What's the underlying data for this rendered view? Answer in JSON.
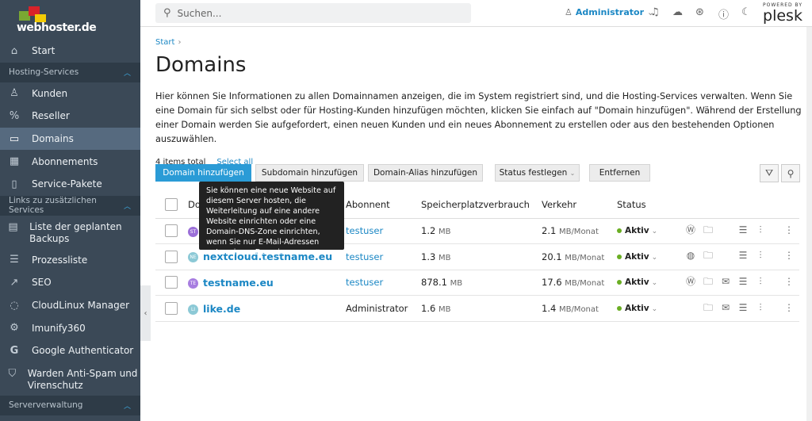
{
  "brand": {
    "logo_text": "webhoster.de",
    "powered_by": "POWERED BY",
    "plesk": "plesk"
  },
  "sidebar": {
    "start": "Start",
    "sections": [
      {
        "title": "Hosting-Services",
        "items": [
          "Kunden",
          "Reseller",
          "Domains",
          "Abonnements",
          "Service-Pakete"
        ]
      },
      {
        "title": "Links zu zusätzlichen Services",
        "items": [
          "Liste der geplanten Backups",
          "Prozessliste",
          "SEO",
          "CloudLinux Manager",
          "Imunify360",
          "Google Authenticator",
          "Warden Anti-Spam und Virenschutz"
        ]
      },
      {
        "title": "Serververwaltung"
      }
    ],
    "active": "Domains"
  },
  "topbar": {
    "search_placeholder": "Suchen...",
    "user": "Administrator"
  },
  "main": {
    "breadcrumb": "Start",
    "title": "Domains",
    "description": "Hier können Sie Informationen zu allen Domainnamen anzeigen, die im System registriert sind, und die Hosting-Services verwalten. Wenn Sie eine Domain für sich selbst oder für Hosting-Kunden hinzufügen möchten, klicken Sie einfach auf \"Domain hinzufügen\". Während der Erstellung einer Domain werden Sie aufgefordert, einen neuen Kunden und ein neues Abonnement zu erstellen oder aus den bestehenden Optionen auszuwählen.",
    "count": "4 items total",
    "select_all": "Select all",
    "buttons": {
      "add_domain": "Domain hinzufügen",
      "add_subdomain": "Subdomain hinzufügen",
      "add_alias": "Domain-Alias hinzufügen",
      "set_status": "Status festlegen",
      "remove": "Entfernen"
    },
    "tooltip": "Sie können eine neue Website auf diesem Server hosten, die Weiterleitung auf eine andere Website einrichten oder eine Domain-DNS-Zone einrichten, wenn Sie nur E-Mail-Adressen unter einem Domainnamen verwenden wollen.",
    "columns": [
      "Do",
      "Abonnent",
      "Speicherplatzverbrauch",
      "Verkehr",
      "Status"
    ],
    "rows": [
      {
        "domain": "",
        "fav": "ST",
        "fav_color": "#9b6fd8",
        "subscriber": "testuser",
        "storage": "1.2",
        "storage_unit": "MB",
        "traffic": "2.1",
        "traffic_unit": "MB/Monat",
        "status": "Aktiv",
        "icons": [
          "wordpress",
          "folder",
          "",
          "database",
          "sliders"
        ]
      },
      {
        "domain": "nextcloud.testname.eu",
        "fav": "NE",
        "fav_color": "#8cc9d6",
        "subscriber": "testuser",
        "storage": "1.3",
        "storage_unit": "MB",
        "traffic": "20.1",
        "traffic_unit": "MB/Monat",
        "status": "Aktiv",
        "icons": [
          "nextcloud",
          "folder",
          "",
          "database",
          "sliders"
        ]
      },
      {
        "domain": "testname.eu",
        "fav": "TE",
        "fav_color": "#a77de0",
        "subscriber": "testuser",
        "storage": "878.1",
        "storage_unit": "MB",
        "traffic": "17.6",
        "traffic_unit": "MB/Monat",
        "status": "Aktiv",
        "icons": [
          "wordpress",
          "folder",
          "mail",
          "database",
          "sliders"
        ]
      },
      {
        "domain": "like.de",
        "fav": "LI",
        "fav_color": "#8cc9d6",
        "subscriber": "Administrator",
        "storage": "1.6",
        "storage_unit": "MB",
        "traffic": "1.4",
        "traffic_unit": "MB/Monat",
        "status": "Aktiv",
        "icons": [
          "",
          "folder",
          "mail",
          "database",
          "sliders"
        ]
      }
    ]
  }
}
